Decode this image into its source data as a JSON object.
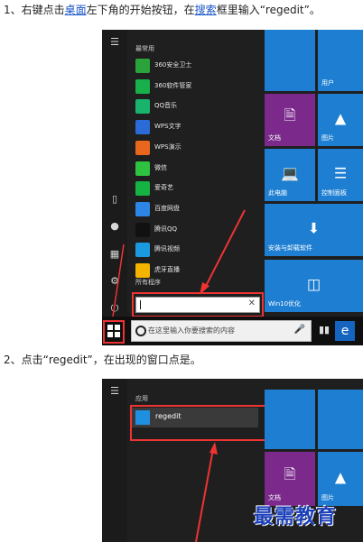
{
  "step1": {
    "prefix": "1、右键点击",
    "link1": "桌面",
    "mid": "左下角的开始按钮，在",
    "link2": "搜索",
    "suffix": "框里输入“regedit”。"
  },
  "step2": {
    "text": "2、点击“regedit”，在出现的窗口点是。"
  },
  "shot1": {
    "section_frequent": "最常用",
    "apps": [
      {
        "label": "360安全卫士",
        "color": "#2aa33a"
      },
      {
        "label": "360软件管家",
        "color": "#18b04a"
      },
      {
        "label": "QQ音乐",
        "color": "#19b36b"
      },
      {
        "label": "WPS文字",
        "color": "#2a6bd8"
      },
      {
        "label": "WPS演示",
        "color": "#e8661e"
      },
      {
        "label": "微信",
        "color": "#2dc240"
      },
      {
        "label": "爱奇艺",
        "color": "#16b243"
      },
      {
        "label": "百度网盘",
        "color": "#2d86e6"
      },
      {
        "label": "腾讯QQ",
        "color": "#111111"
      },
      {
        "label": "腾讯视频",
        "color": "#1a9be0"
      },
      {
        "label": "虎牙直播",
        "color": "#f4b400"
      }
    ],
    "section_all": "所有程序",
    "tiles": {
      "users": "用户",
      "docs": "文档",
      "pics": "图片",
      "pc": "此电脑",
      "control": "控制面板",
      "install": "安装与卸载软件",
      "win10": "Win10优化"
    },
    "taskbar_search_placeholder": "在这里输入你要搜索的内容",
    "accent": "#1e7fd2",
    "purple": "#7b2a8c"
  },
  "shot2": {
    "section_apps": "应用",
    "result_label": "regedit",
    "tiles": {
      "docs": "文档",
      "pics": "图片"
    }
  },
  "watermark": "最需教育"
}
